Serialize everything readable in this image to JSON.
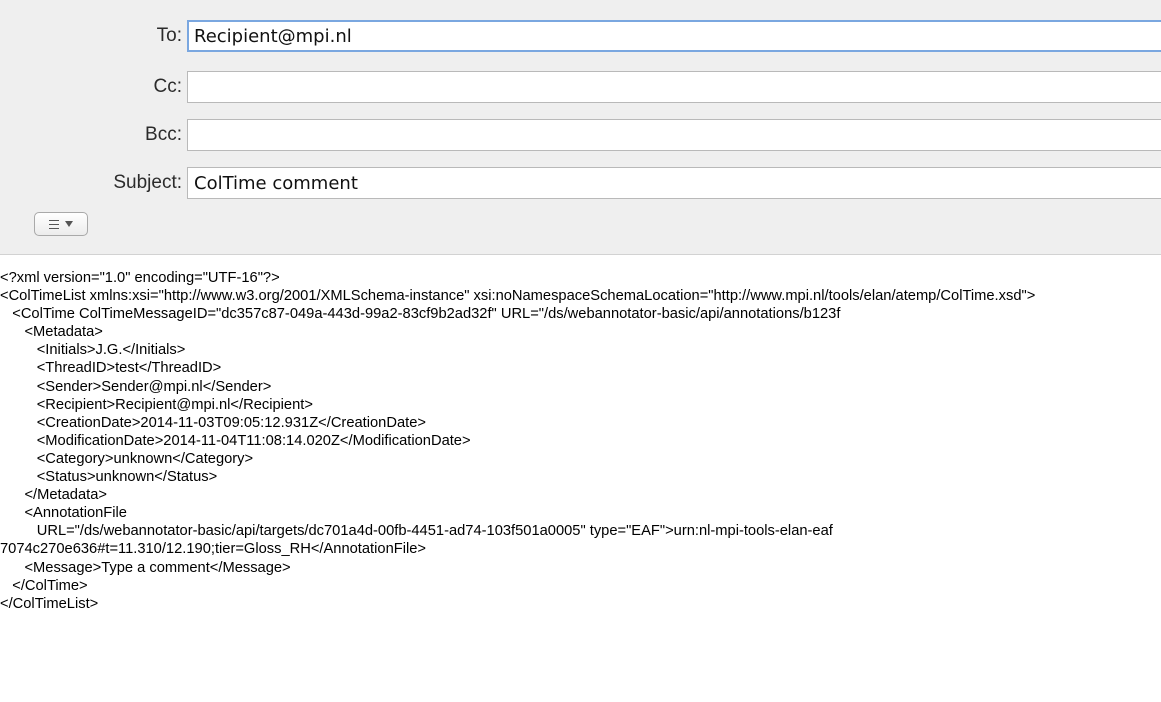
{
  "header": {
    "fields": {
      "to": {
        "label": "To:",
        "value": "Recipient@mpi.nl"
      },
      "cc": {
        "label": "Cc:",
        "value": ""
      },
      "bcc": {
        "label": "Bcc:",
        "value": ""
      },
      "subject": {
        "label": "Subject:",
        "value": "ColTime comment"
      }
    },
    "format_menu": {
      "icon": "list-format-icon",
      "chevron": "chevron-down-icon"
    }
  },
  "body": {
    "lines": [
      "<?xml version=\"1.0\" encoding=\"UTF-16\"?>",
      "<ColTimeList xmlns:xsi=\"http://www.w3.org/2001/XMLSchema-instance\" xsi:noNamespaceSchemaLocation=\"http://www.mpi.nl/tools/elan/atemp/ColTime.xsd\">",
      "   <ColTime ColTimeMessageID=\"dc357c87-049a-443d-99a2-83cf9b2ad32f\" URL=\"/ds/webannotator-basic/api/annotations/b123f",
      "      <Metadata>",
      "         <Initials>J.G.</Initials>",
      "         <ThreadID>test</ThreadID>",
      "         <Sender>Sender@mpi.nl</Sender>",
      "         <Recipient>Recipient@mpi.nl</Recipient>",
      "         <CreationDate>2014-11-03T09:05:12.931Z</CreationDate>",
      "         <ModificationDate>2014-11-04T11:08:14.020Z</ModificationDate>",
      "         <Category>unknown</Category>",
      "         <Status>unknown</Status>",
      "      </Metadata>",
      "      <AnnotationFile",
      "         URL=\"/ds/webannotator-basic/api/targets/dc701a4d-00fb-4451-ad74-103f501a0005\" type=\"EAF\">urn:nl-mpi-tools-elan-eaf",
      "7074c270e636#t=11.310/12.190;tier=Gloss_RH</AnnotationFile>",
      "      <Message>Type a comment</Message>",
      "   </ColTime>",
      "</ColTimeList>"
    ]
  }
}
